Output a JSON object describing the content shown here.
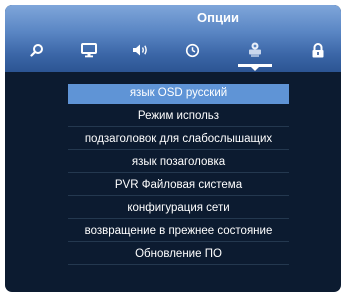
{
  "header": {
    "title": "Опции"
  },
  "tabs": [
    {
      "name": "search",
      "icon": "search-icon"
    },
    {
      "name": "picture",
      "icon": "monitor-icon"
    },
    {
      "name": "sound",
      "icon": "speaker-icon"
    },
    {
      "name": "time",
      "icon": "clock-icon"
    },
    {
      "name": "options",
      "icon": "options-icon",
      "active": true
    },
    {
      "name": "lock",
      "icon": "lock-icon"
    }
  ],
  "menu": {
    "items": [
      {
        "label": "язык OSD русский",
        "selected": true
      },
      {
        "label": "Режим использ"
      },
      {
        "label": "подзаголовок для слабослышащих"
      },
      {
        "label": "язык позаголовка"
      },
      {
        "label": "PVR Файловая система"
      },
      {
        "label": "конфигурация сети"
      },
      {
        "label": "возвращение в прежнее состояние"
      },
      {
        "label": "Обновление ПО"
      }
    ]
  },
  "colors": {
    "background": "#0c1b30",
    "header_gradient_top": "#7fa6da",
    "header_gradient_bottom": "#2c5593",
    "selection": "#5f94d6",
    "text": "#ffffff"
  }
}
